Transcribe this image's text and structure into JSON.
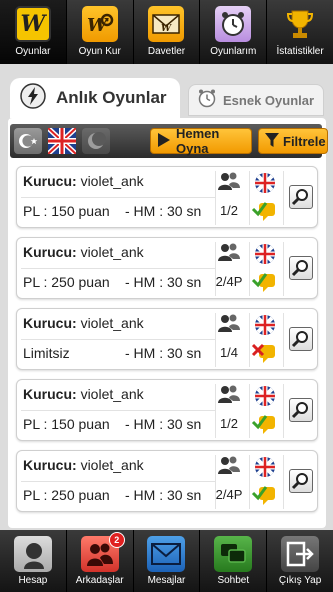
{
  "top_nav": {
    "items": [
      {
        "label": "Oyunlar",
        "icon": "w-logo-icon",
        "active": true
      },
      {
        "label": "Oyun Kur",
        "icon": "gears-icon"
      },
      {
        "label": "Davetler",
        "icon": "envelope-icon"
      },
      {
        "label": "Oyunlarım",
        "icon": "alarm-clock-icon"
      },
      {
        "label": "İstatistikler",
        "icon": "trophy-icon"
      }
    ]
  },
  "tabs": {
    "live_label": "Anlık Oyunlar",
    "flexible_label": "Esnek Oyunlar"
  },
  "filter_bar": {
    "play_now_label": "Hemen Oyna",
    "filter_label": "Filtrele"
  },
  "games": [
    {
      "creator_label": "Kurucu:",
      "creator": "violet_ank",
      "points": "PL : 150 puan",
      "hm": "- HM : 30 sn",
      "slots": "1/2",
      "status": "ok"
    },
    {
      "creator_label": "Kurucu:",
      "creator": "violet_ank",
      "points": "PL : 250 puan",
      "hm": "- HM : 30 sn",
      "slots": "2/4P",
      "status": "ok"
    },
    {
      "creator_label": "Kurucu:",
      "creator": "violet_ank",
      "points": "Limitsiz",
      "hm": "- HM : 30 sn",
      "slots": "1/4",
      "status": "no"
    },
    {
      "creator_label": "Kurucu:",
      "creator": "violet_ank",
      "points": "PL : 150 puan",
      "hm": "- HM : 30 sn",
      "slots": "1/2",
      "status": "ok"
    },
    {
      "creator_label": "Kurucu:",
      "creator": "violet_ank",
      "points": "PL : 250 puan",
      "hm": "- HM : 30 sn",
      "slots": "2/4P",
      "status": "ok"
    }
  ],
  "bottom_nav": {
    "items": [
      {
        "label": "Hesap",
        "icon": "profile-icon"
      },
      {
        "label": "Arkadaşlar",
        "icon": "friends-icon",
        "badge": "2"
      },
      {
        "label": "Mesajlar",
        "icon": "mail-icon"
      },
      {
        "label": "Sohbet",
        "icon": "chat-icon"
      },
      {
        "label": "Çıkış Yap",
        "icon": "exit-icon"
      }
    ]
  },
  "colors": {
    "accent": "#f29a00",
    "nav_bg": "#1e1e1e",
    "ok_green": "#3aa12a",
    "no_red": "#d92020"
  }
}
